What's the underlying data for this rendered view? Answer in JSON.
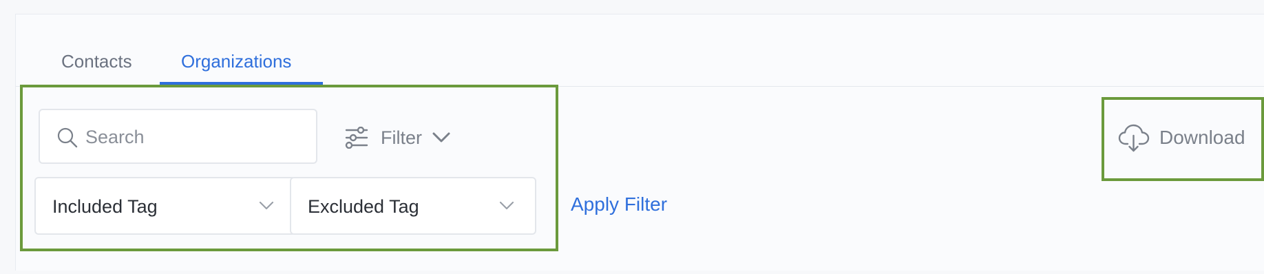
{
  "tabs": [
    {
      "label": "Contacts",
      "active": false
    },
    {
      "label": "Organizations",
      "active": true
    }
  ],
  "search": {
    "placeholder": "Search",
    "value": ""
  },
  "filter": {
    "label": "Filter",
    "icon": "sliders-icon"
  },
  "tag_filters": {
    "included_label": "Included Tag",
    "excluded_label": "Excluded Tag"
  },
  "apply_filter_label": "Apply Filter",
  "download": {
    "label": "Download",
    "icon": "cloud-download-icon"
  },
  "colors": {
    "accent": "#2f6fdc",
    "highlight_box": "#6b9a3c",
    "muted_text": "#7a808a"
  }
}
